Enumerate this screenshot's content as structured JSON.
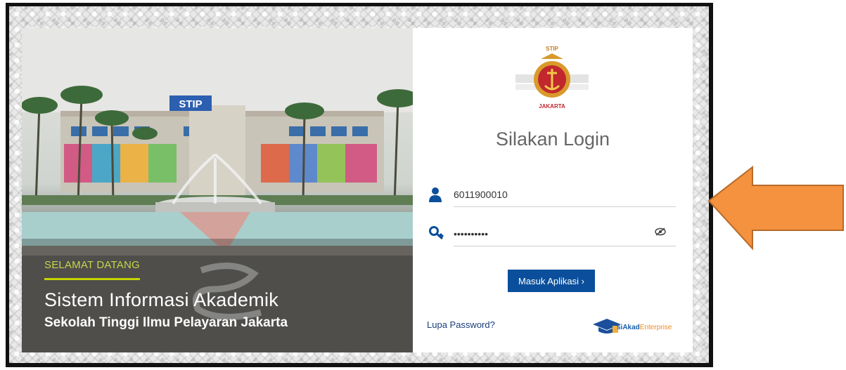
{
  "hero": {
    "building_sign": "STIP",
    "welcome": "SELAMAT DATANG",
    "title": "Sistem Informasi Akademik",
    "subtitle": "Sekolah Tinggi Ilmu Pelayaran Jakarta"
  },
  "login": {
    "logo_caption": "JAKARTA",
    "logo_top": "STIP",
    "heading": "Silakan Login",
    "username_value": "6011900010",
    "password_value": "••••••••••",
    "submit_label": "Masuk Aplikasi ›",
    "forgot_label": "Lupa Password?",
    "brand_name": "siAkad",
    "brand_suffix": "Enterprise"
  },
  "colors": {
    "accent": "#0b4f9c",
    "welcome": "#c5d400",
    "arrow": "#f4923f"
  }
}
